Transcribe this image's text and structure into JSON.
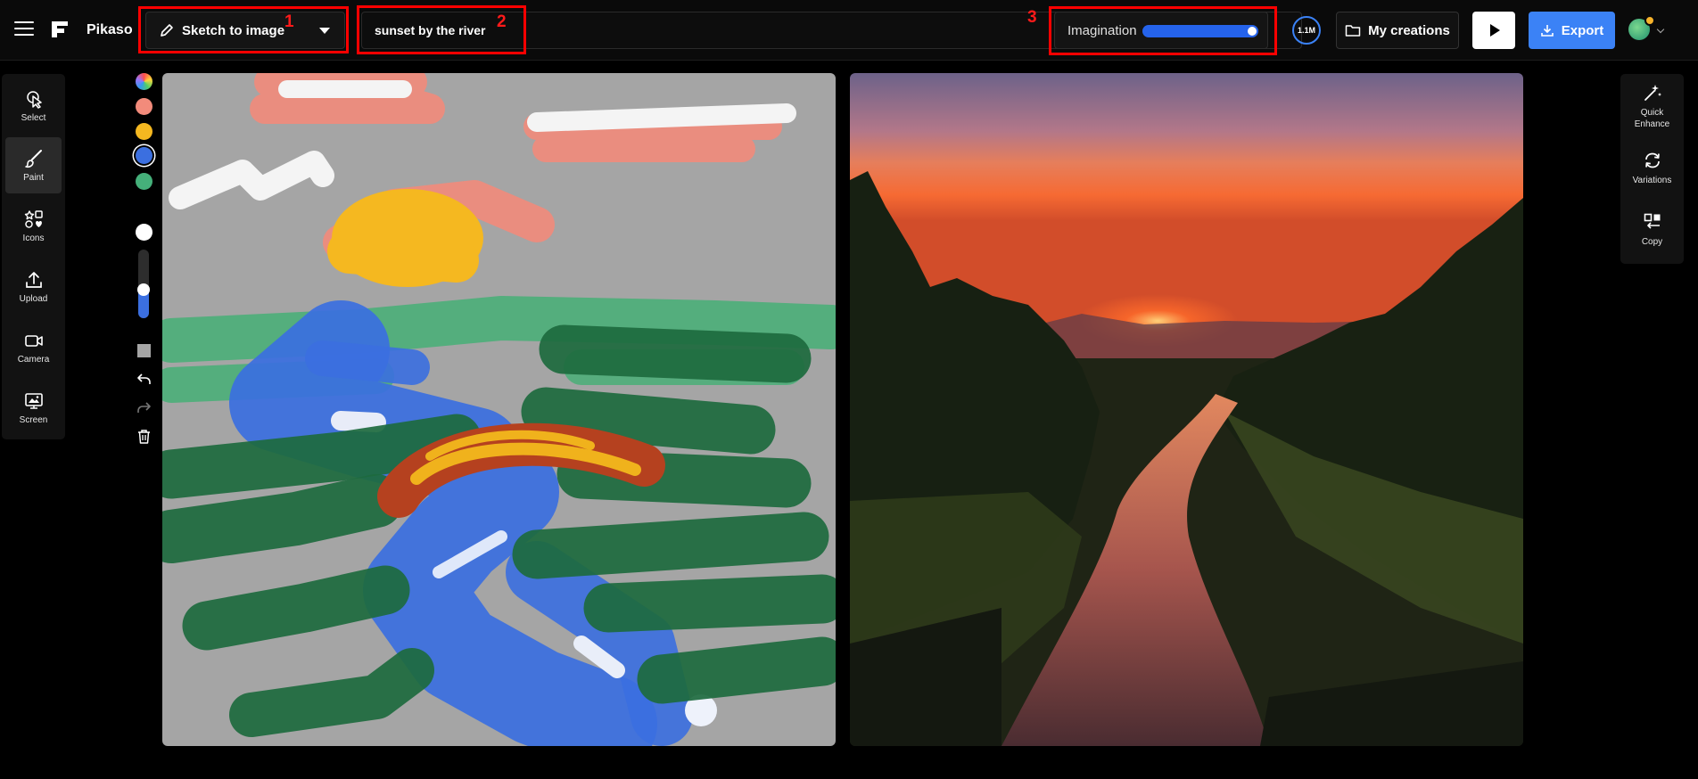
{
  "app": {
    "name": "Pikaso"
  },
  "toolbar": {
    "mode_label": "Sketch to image",
    "prompt_value": "sunset by the river",
    "imagination_label": "Imagination",
    "imagination_level": 0.95,
    "credits": "1.1M",
    "my_creations_label": "My creations",
    "export_label": "Export"
  },
  "annotations": [
    "1",
    "2",
    "3"
  ],
  "left_tools": [
    {
      "label": "Select",
      "icon": "pointer-icon"
    },
    {
      "label": "Paint",
      "icon": "brush-icon",
      "active": true
    },
    {
      "label": "Icons",
      "icon": "shapes-icon"
    },
    {
      "label": "Upload",
      "icon": "upload-icon"
    },
    {
      "label": "Camera",
      "icon": "video-camera-icon"
    },
    {
      "label": "Screen",
      "icon": "screen-share-icon"
    }
  ],
  "palette": [
    {
      "name": "rainbow",
      "color": "conic"
    },
    {
      "name": "salmon",
      "color": "#f28b7b"
    },
    {
      "name": "amber",
      "color": "#f5b820"
    },
    {
      "name": "blue",
      "color": "#3b6fe0"
    },
    {
      "name": "green",
      "color": "#45b07a"
    }
  ],
  "brush": {
    "color": "#ffffff",
    "size_level": 0.55
  },
  "right_tools": [
    {
      "label": "Quick Enhance",
      "icon": "magic-wand-icon"
    },
    {
      "label": "Variations",
      "icon": "refresh-icon"
    },
    {
      "label": "Copy",
      "icon": "copy-icon"
    }
  ],
  "colors": {
    "accent": "#3b82f6",
    "annotation": "#ff0000",
    "background": "#000000"
  }
}
